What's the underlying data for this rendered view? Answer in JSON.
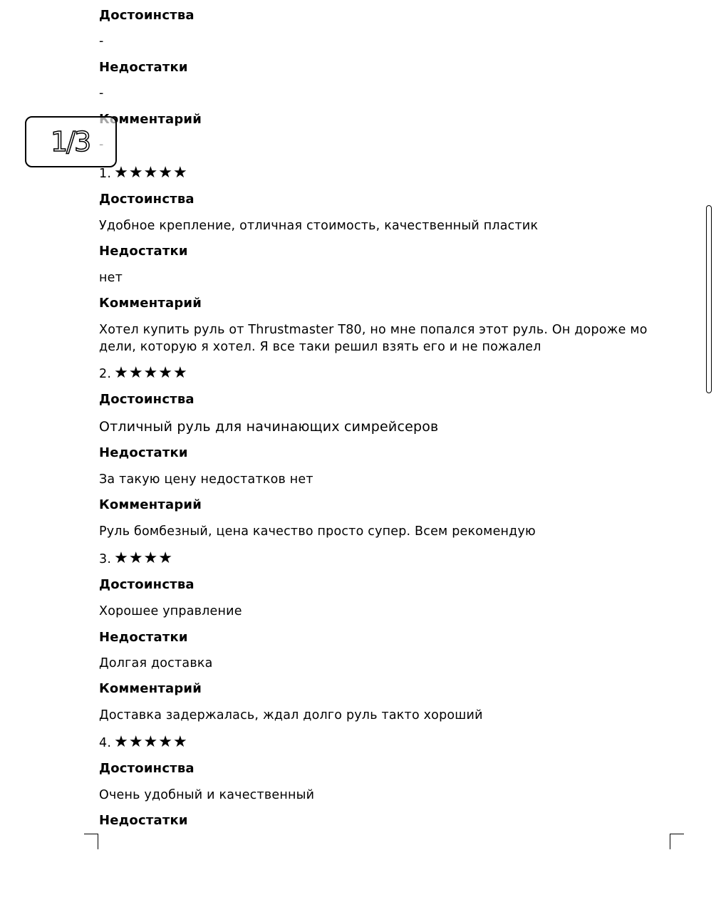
{
  "page_indicator": "1/3",
  "review0": {
    "pros_heading": "Достоинства",
    "pros_text": "-",
    "cons_heading": "Недостатки",
    "cons_text": "-",
    "comment_heading": "Комментарий",
    "comment_text": "-"
  },
  "reviews": [
    {
      "number": "1.",
      "stars": "★★★★★",
      "star_count": 5,
      "pros_heading": "Достоинства",
      "pros_text": "Удобное крепление, отличная стоимость, качественный пластик",
      "cons_heading": "Недостатки",
      "cons_text": "нет",
      "comment_heading": "Комментарий",
      "comment_text": "Хотел купить руль от Thrustmaster T80, но мне попался этот руль. Он дороже мо дели, которую я хотел. Я все таки решил взять его и не пожалел"
    },
    {
      "number": "2.",
      "stars": "★★★★★",
      "star_count": 5,
      "pros_heading": "Достоинства",
      "pros_text": "Отличный руль для начинающих симрейсеров",
      "cons_heading": "Недостатки",
      "cons_text": "За такую цену недостатков нет",
      "comment_heading": "Комментарий",
      "comment_text": "Руль бомбезный, цена качество просто супер. Всем рекомендую"
    },
    {
      "number": "3.",
      "stars": "★★★★",
      "star_count": 4,
      "pros_heading": "Достоинства",
      "pros_text": "Хорошее управление",
      "cons_heading": "Недостатки",
      "cons_text": "Долгая доставка",
      "comment_heading": "Комментарий",
      "comment_text": "Доставка задержалась, ждал долго руль такто хороший"
    },
    {
      "number": "4.",
      "stars": "★★★★★",
      "star_count": 5,
      "pros_heading": "Достоинства",
      "pros_text": "Очень удобный и качественный",
      "cons_heading": "Недостатки"
    }
  ]
}
